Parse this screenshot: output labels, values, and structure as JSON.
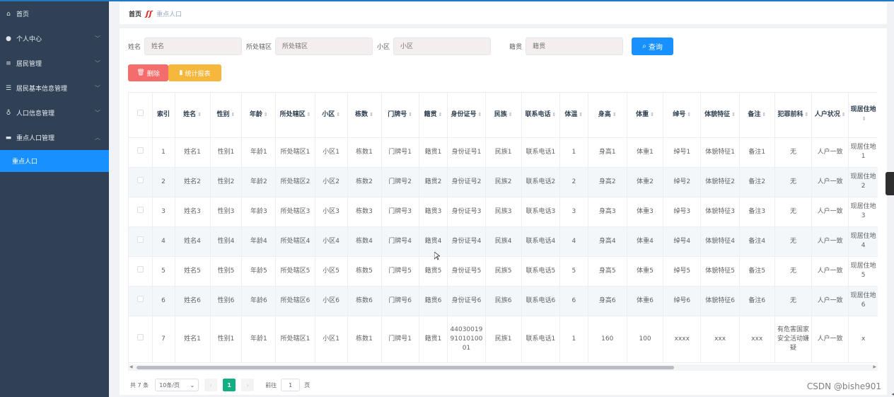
{
  "sidebar": {
    "items": [
      {
        "label": "首页",
        "icon": "home-icon",
        "glyph": "⌂",
        "has_children": false
      },
      {
        "label": "个人中心",
        "icon": "user-icon",
        "glyph": "●",
        "has_children": true
      },
      {
        "label": "居民管理",
        "icon": "list-icon",
        "glyph": "≡",
        "has_children": true
      },
      {
        "label": "居民基本信息管理",
        "icon": "menu-icon",
        "glyph": "☰",
        "has_children": true
      },
      {
        "label": "人口信息管理",
        "icon": "mic-icon",
        "glyph": "♁",
        "has_children": true
      },
      {
        "label": "重点人口管理",
        "icon": "folder-icon",
        "glyph": "▬",
        "has_children": true,
        "expanded": true
      }
    ],
    "active_sub": "重点人口"
  },
  "breadcrumb": {
    "home": "首页",
    "sep": "ʃʃ",
    "current": "重点人口"
  },
  "search": [
    {
      "label": "姓名",
      "placeholder": "姓名"
    },
    {
      "label": "所处辖区",
      "placeholder": "所处辖区"
    },
    {
      "label": "小区",
      "placeholder": "小区"
    },
    {
      "label": "籍贯",
      "placeholder": "籍贯"
    }
  ],
  "buttons": {
    "query": "查询",
    "delete": "删除",
    "stats": "统计报表"
  },
  "table": {
    "headers": [
      "索引",
      "姓名",
      "性别",
      "年龄",
      "所处辖区",
      "小区",
      "栋数",
      "门牌号",
      "籍贯",
      "身份证号",
      "民族",
      "联系电话",
      "体温",
      "身高",
      "体重",
      "绰号",
      "体貌特征",
      "备注",
      "犯罪前科",
      "人户状况",
      "现居住地"
    ],
    "rows": [
      [
        "1",
        "姓名1",
        "性别1",
        "年龄1",
        "所处辖区1",
        "小区1",
        "栋数1",
        "门牌号1",
        "籍贯1",
        "身份证号1",
        "民族1",
        "联系电话1",
        "1",
        "身高1",
        "体重1",
        "绰号1",
        "体貌特征1",
        "备注1",
        "无",
        "人户一致",
        "现居住地1"
      ],
      [
        "2",
        "姓名2",
        "性别2",
        "年龄2",
        "所处辖区2",
        "小区2",
        "栋数2",
        "门牌号2",
        "籍贯2",
        "身份证号2",
        "民族2",
        "联系电话2",
        "2",
        "身高2",
        "体重2",
        "绰号2",
        "体貌特征2",
        "备注2",
        "无",
        "人户一致",
        "现居住地2"
      ],
      [
        "3",
        "姓名3",
        "性别3",
        "年龄3",
        "所处辖区3",
        "小区3",
        "栋数3",
        "门牌号3",
        "籍贯3",
        "身份证号3",
        "民族3",
        "联系电话3",
        "3",
        "身高3",
        "体重3",
        "绰号3",
        "体貌特征3",
        "备注3",
        "无",
        "人户一致",
        "现居住地3"
      ],
      [
        "4",
        "姓名4",
        "性别4",
        "年龄4",
        "所处辖区4",
        "小区4",
        "栋数4",
        "门牌号4",
        "籍贯4",
        "身份证号4",
        "民族4",
        "联系电话4",
        "4",
        "身高4",
        "体重4",
        "绰号4",
        "体貌特征4",
        "备注4",
        "无",
        "人户一致",
        "现居住地4"
      ],
      [
        "5",
        "姓名5",
        "性别5",
        "年龄5",
        "所处辖区5",
        "小区5",
        "栋数5",
        "门牌号5",
        "籍贯5",
        "身份证号5",
        "民族5",
        "联系电话5",
        "5",
        "身高5",
        "体重5",
        "绰号5",
        "体貌特征5",
        "备注5",
        "无",
        "人户一致",
        "现居住地5"
      ],
      [
        "6",
        "姓名6",
        "性别6",
        "年龄6",
        "所处辖区6",
        "小区6",
        "栋数6",
        "门牌号6",
        "籍贯6",
        "身份证号6",
        "民族6",
        "联系电话6",
        "6",
        "身高6",
        "体重6",
        "绰号6",
        "体貌特征6",
        "备注6",
        "无",
        "人户一致",
        "现居住地6"
      ],
      [
        "7",
        "姓名1",
        "性别1",
        "年龄1",
        "所处辖区1",
        "小区1",
        "栋数1",
        "门牌号1",
        "籍贯1",
        "440300199101010001",
        "民族1",
        "联系电话1",
        "1",
        "160",
        "100",
        "xxxx",
        "xxx",
        "xxx",
        "有危害国家安全活动嫌疑",
        "人户一致",
        "x"
      ]
    ]
  },
  "pagination": {
    "total": "共 7 条",
    "page_size": "10条/页",
    "current_page": "1",
    "goto_label": "前往",
    "goto_value": "1",
    "page_suffix": "页"
  },
  "watermark": "CSDN @bishe901",
  "colors": {
    "sidebar": "#304156",
    "active": "#1890ff",
    "primary": "#1890ff",
    "danger": "#f56c6c",
    "warning": "#f6b83c",
    "page_active": "#13ae84"
  }
}
